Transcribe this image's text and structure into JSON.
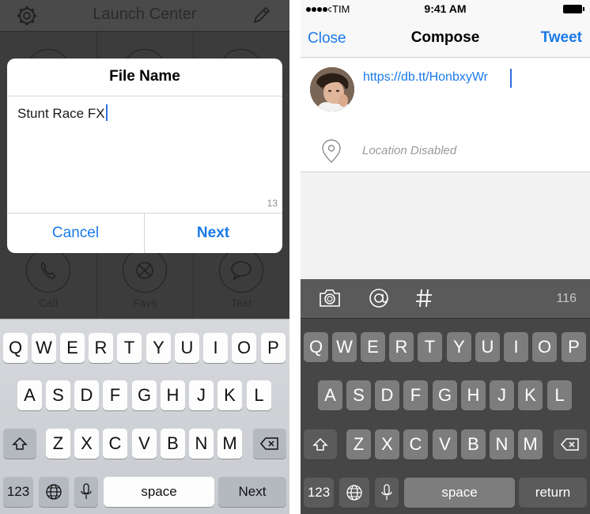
{
  "left": {
    "app_title": "Launch Center",
    "grid_labels": [
      "Call",
      "Favs",
      "Text"
    ],
    "dialog": {
      "title": "File Name",
      "input_value": "Stunt Race FX",
      "char_count": "13",
      "cancel_label": "Cancel",
      "next_label": "Next"
    },
    "keyboard": {
      "row1": [
        "Q",
        "W",
        "E",
        "R",
        "T",
        "Y",
        "U",
        "I",
        "O",
        "P"
      ],
      "row2": [
        "A",
        "S",
        "D",
        "F",
        "G",
        "H",
        "J",
        "K",
        "L"
      ],
      "row3": [
        "Z",
        "X",
        "C",
        "V",
        "B",
        "N",
        "M"
      ],
      "numbers_label": "123",
      "space_label": "space",
      "return_label": "Next"
    }
  },
  "right": {
    "status": {
      "carrier": "TIM",
      "time": "9:41 AM"
    },
    "nav": {
      "close_label": "Close",
      "title": "Compose",
      "tweet_label": "Tweet"
    },
    "compose": {
      "text": "https://db.tt/HonbxyWr",
      "location": "Location Disabled"
    },
    "toolbar": {
      "char_remaining": "116"
    },
    "keyboard": {
      "row1": [
        "Q",
        "W",
        "E",
        "R",
        "T",
        "Y",
        "U",
        "I",
        "O",
        "P"
      ],
      "row2": [
        "A",
        "S",
        "D",
        "F",
        "G",
        "H",
        "J",
        "K",
        "L"
      ],
      "row3": [
        "Z",
        "X",
        "C",
        "V",
        "B",
        "N",
        "M"
      ],
      "numbers_label": "123",
      "space_label": "space",
      "return_label": "return"
    }
  },
  "colors": {
    "accent": "#1a7ae8",
    "caret": "#2f6fe0"
  }
}
